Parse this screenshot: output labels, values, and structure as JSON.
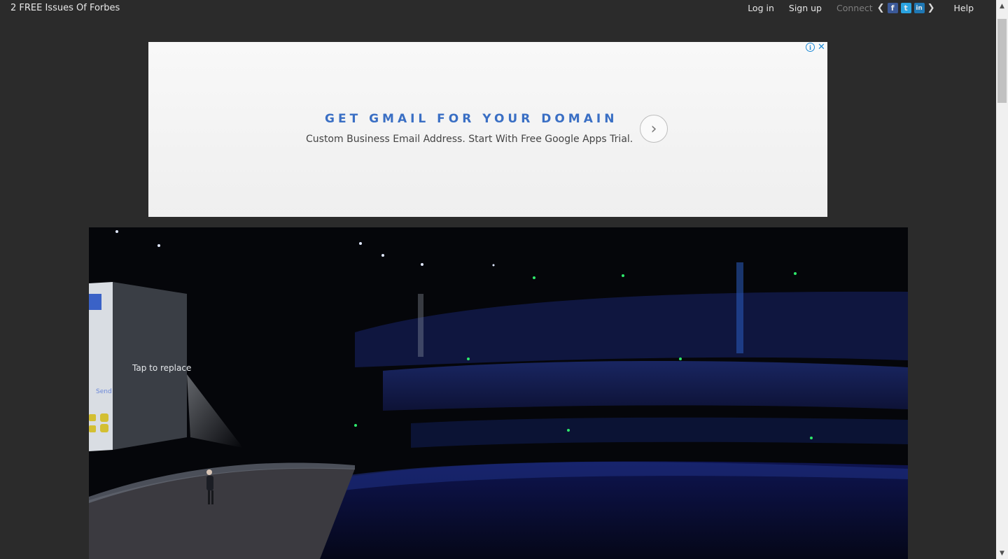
{
  "topbar": {
    "promo_text": "2 FREE Issues Of Forbes",
    "login_label": "Log in",
    "signup_label": "Sign up",
    "connect_label": "Connect",
    "social": {
      "facebook_letter": "f",
      "twitter_letter": "t",
      "linkedin_letter": "in"
    },
    "help_label": "Help"
  },
  "ad": {
    "headline": "GET GMAIL FOR YOUR DOMAIN",
    "text": "Custom Business Email Address. Start With Free Google Apps Trial.",
    "info_icon": "info-icon",
    "close_icon": "close-icon",
    "arrow_icon": "chevron-right-icon"
  },
  "hero": {
    "screen_text": "Tap to replace",
    "screen_side_text": "Send"
  },
  "colors": {
    "page_background": "#2b2b2b",
    "ad_headline": "#3a6fc4",
    "facebook": "#3b5998",
    "twitter": "#2aa3e0",
    "linkedin": "#1f78b4"
  }
}
